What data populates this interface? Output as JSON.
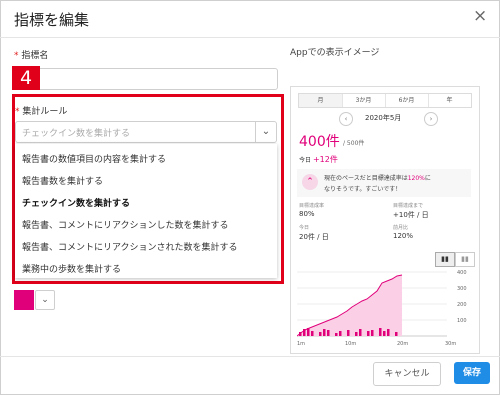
{
  "dialog": {
    "title": "指標を編集",
    "close_icon": "×"
  },
  "form": {
    "required_mark": "*",
    "metric_name_label": "指標名",
    "metric_name_value": "",
    "aggregation_label": "集計ルール",
    "aggregation_placeholder": "チェックイン数を集計する",
    "options": [
      "報告書の数値項目の内容を集計する",
      "報告書数を集計する",
      "チェックイン数を集計する",
      "報告書、コメントにリアクションした数を集計する",
      "報告書、コメントにリアクションされた数を集計する",
      "業務中の歩数を集計する"
    ],
    "selected_index": 2,
    "color_value": "#e0007a"
  },
  "callout": {
    "number": "4",
    "color": "#e0001a"
  },
  "preview": {
    "title": "Appでの表示イメージ",
    "tabs": [
      "月",
      "3か月",
      "6か月",
      "年"
    ],
    "active_tab": 0,
    "period": "2020年5月",
    "value": "400件",
    "target": "/ 500件",
    "today_label": "今日",
    "today_value": "+12件",
    "message_line1_a": "現在のペースだと目標達成率は",
    "message_line1_b": "120%",
    "message_line1_c": "に",
    "message_line2": "なりそうです。すごいです！",
    "stats": [
      {
        "label": "目標達成率",
        "value": "80%"
      },
      {
        "label": "目標達成まで",
        "value": "+10件 / 日"
      },
      {
        "label": "今日",
        "value": "20件 / 日"
      },
      {
        "label": "前月比",
        "value": "120%"
      }
    ],
    "y_ticks": [
      "400",
      "300",
      "200",
      "100"
    ],
    "x_ticks": [
      "1m",
      "10m",
      "20m",
      "30m"
    ],
    "accent": "#e0007a"
  },
  "footer": {
    "cancel_label": "キャンセル",
    "save_label": "保存"
  }
}
